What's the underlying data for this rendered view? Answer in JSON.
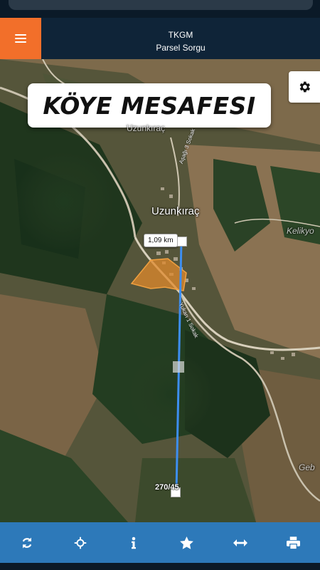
{
  "header": {
    "title_line1": "TKGM",
    "title_line2": "Parsel Sorgu"
  },
  "banner": {
    "text": "KÖYE MESAFESI"
  },
  "map": {
    "labels": {
      "village_faded": "Uzunkıraç",
      "village": "Uzunkıraç",
      "neighbor": "Kelikyo",
      "neighbor2": "Geb",
      "road1": "Aşağı 3 Sokak",
      "road2": "Yukarı 1 Sokak"
    },
    "measurement": {
      "distance": "1,09 km",
      "parcel": "270/45"
    }
  },
  "toolbar": {
    "items": [
      "refresh-icon",
      "locate-icon",
      "info-icon",
      "star-icon",
      "measure-icon",
      "print-icon"
    ]
  },
  "colors": {
    "header_bg": "#0f2438",
    "menu_accent": "#f26f2a",
    "toolbar_bg": "#2d79b9",
    "measure_line": "#3d8ef0",
    "parcel_fill": "#e08a2c"
  }
}
